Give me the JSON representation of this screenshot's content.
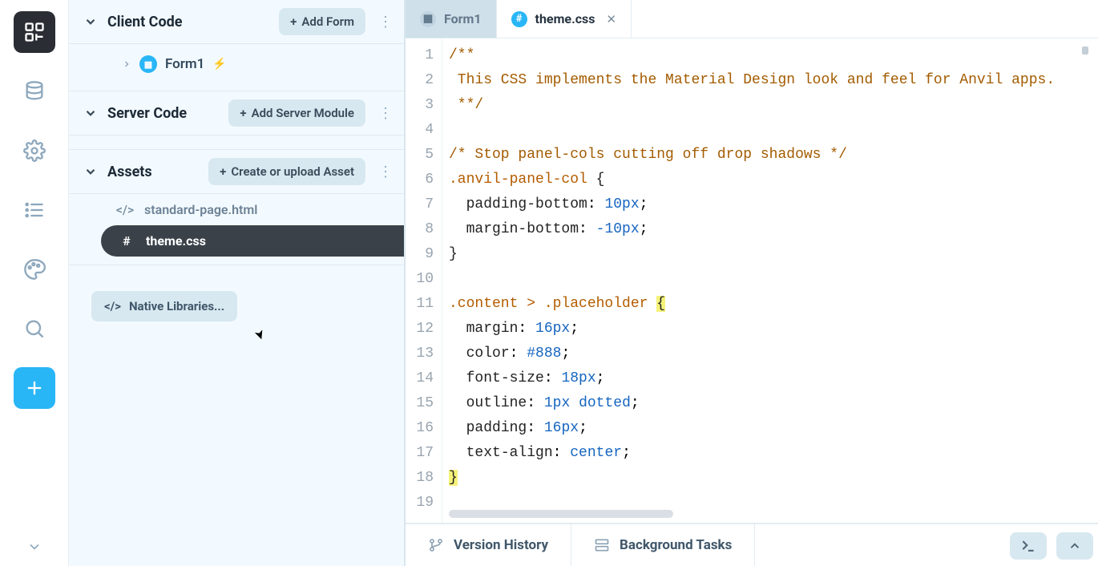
{
  "sections": {
    "client_code": {
      "title": "Client Code",
      "add_label": "Add Form"
    },
    "server_code": {
      "title": "Server Code",
      "add_label": "Add Server Module"
    },
    "assets": {
      "title": "Assets",
      "add_label": "Create or upload Asset"
    }
  },
  "forms": [
    {
      "name": "Form1"
    }
  ],
  "assets": [
    {
      "name": "standard-page.html",
      "icon": "code-tag",
      "active": false
    },
    {
      "name": "theme.css",
      "icon": "hash",
      "active": true
    }
  ],
  "native_libraries_label": "Native Libraries...",
  "tabs": [
    {
      "label": "Form1",
      "icon_bg": "#bfd4e0",
      "icon_fg": "#5a7386",
      "icon_glyph": "▦",
      "active": false,
      "closable": false
    },
    {
      "label": "theme.css",
      "icon_bg": "#29b6f6",
      "icon_fg": "#ffffff",
      "icon_glyph": "#",
      "active": true,
      "closable": true
    }
  ],
  "code": {
    "highlighted_line_index": 10,
    "lines": [
      {
        "n": 1,
        "kind": "comment",
        "text": "/**"
      },
      {
        "n": 2,
        "kind": "comment",
        "text": " This CSS implements the Material Design look and feel for Anvil apps."
      },
      {
        "n": 3,
        "kind": "comment",
        "text": " **/"
      },
      {
        "n": 4,
        "kind": "blank",
        "text": ""
      },
      {
        "n": 5,
        "kind": "comment",
        "text": "/* Stop panel-cols cutting off drop shadows */"
      },
      {
        "n": 6,
        "kind": "sel-open",
        "selector": ".anvil-panel-col"
      },
      {
        "n": 7,
        "kind": "decl",
        "prop": "padding-bottom",
        "value": "10px",
        "vclass": "cm-num"
      },
      {
        "n": 8,
        "kind": "decl",
        "prop": "margin-bottom",
        "value": "-10px",
        "vclass": "cm-num"
      },
      {
        "n": 9,
        "kind": "close"
      },
      {
        "n": 10,
        "kind": "blank",
        "text": ""
      },
      {
        "n": 11,
        "kind": "sel-open-match",
        "selector": ".content > .placeholder"
      },
      {
        "n": 12,
        "kind": "decl",
        "prop": "margin",
        "value": "16px",
        "vclass": "cm-num"
      },
      {
        "n": 13,
        "kind": "decl",
        "prop": "color",
        "value": "#888",
        "vclass": "cm-hex"
      },
      {
        "n": 14,
        "kind": "decl",
        "prop": "font-size",
        "value": "18px",
        "vclass": "cm-num"
      },
      {
        "n": 15,
        "kind": "decl2",
        "prop": "outline",
        "v1": "1px",
        "v2": "dotted"
      },
      {
        "n": 16,
        "kind": "decl",
        "prop": "padding",
        "value": "16px",
        "vclass": "cm-num"
      },
      {
        "n": 17,
        "kind": "decl",
        "prop": "text-align",
        "value": "center",
        "vclass": "cm-kw"
      },
      {
        "n": 18,
        "kind": "close-match"
      },
      {
        "n": 19,
        "kind": "blank",
        "text": ""
      }
    ]
  },
  "statusbar": {
    "version_history": "Version History",
    "background_tasks": "Background Tasks"
  }
}
